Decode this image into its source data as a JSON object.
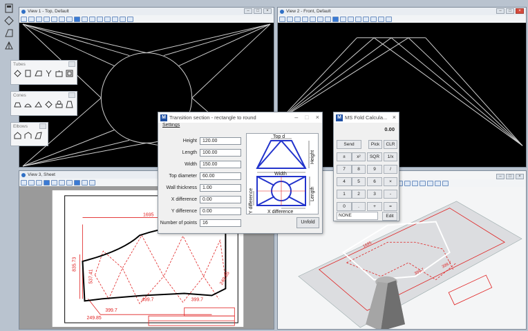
{
  "views": {
    "view1": {
      "title": "View 1 - Top, Default"
    },
    "view2": {
      "title": "View 2 - Front, Default"
    },
    "view3": {
      "title": "View 3, Sheet"
    },
    "view4": {
      "title": ""
    }
  },
  "palettes": {
    "tubes": {
      "title": "Tubes"
    },
    "cones": {
      "title": "Cones"
    },
    "elbows": {
      "title": "Elbows"
    }
  },
  "transition_dialog": {
    "title": "Transition section - rectangle to round",
    "menu": "Settings",
    "fields": [
      {
        "label": "Height",
        "value": "120.00"
      },
      {
        "label": "Length",
        "value": "100.00"
      },
      {
        "label": "Width",
        "value": "150.00"
      },
      {
        "label": "Top diameter",
        "value": "60.00"
      },
      {
        "label": "Wall thickness",
        "value": "1.00"
      },
      {
        "label": "X difference",
        "value": "0.00"
      },
      {
        "label": "Y difference",
        "value": "0.00"
      },
      {
        "label": "Number of points",
        "value": "16"
      }
    ],
    "preview_labels": {
      "top_d": "Top d",
      "height": "Height",
      "width": "Width",
      "length": "Length",
      "y_diff": "Y difference",
      "x_diff": "X difference"
    },
    "unfold_label": "Unfold"
  },
  "calculator": {
    "title": "MS Fold Calcula...",
    "display": "0.00",
    "rows": [
      [
        "Send",
        "Pick",
        "CLR"
      ],
      [
        "±",
        "x²",
        "SQR",
        "1/x"
      ],
      [
        "7",
        "8",
        "9",
        "/"
      ],
      [
        "4",
        "5",
        "6",
        "×"
      ],
      [
        "1",
        "2",
        "3",
        "-"
      ],
      [
        "0",
        ".",
        "+",
        "="
      ]
    ],
    "status": "NONE",
    "edit_label": "Edit"
  },
  "drawing_dims": {
    "d1": "1695",
    "d2": "835.73",
    "d3": "537.41",
    "d4": "499.7",
    "d5": "399.7",
    "d6": "249.85",
    "d7": "249.85",
    "d8": "399.7"
  },
  "iso_dims": {
    "d1": "1695",
    "d2": "399.7",
    "d3": "399.7"
  },
  "colors": {
    "accent": "#3a7ad4",
    "drawing_red": "#e01f1f",
    "blue_frame": "#2233cc"
  }
}
